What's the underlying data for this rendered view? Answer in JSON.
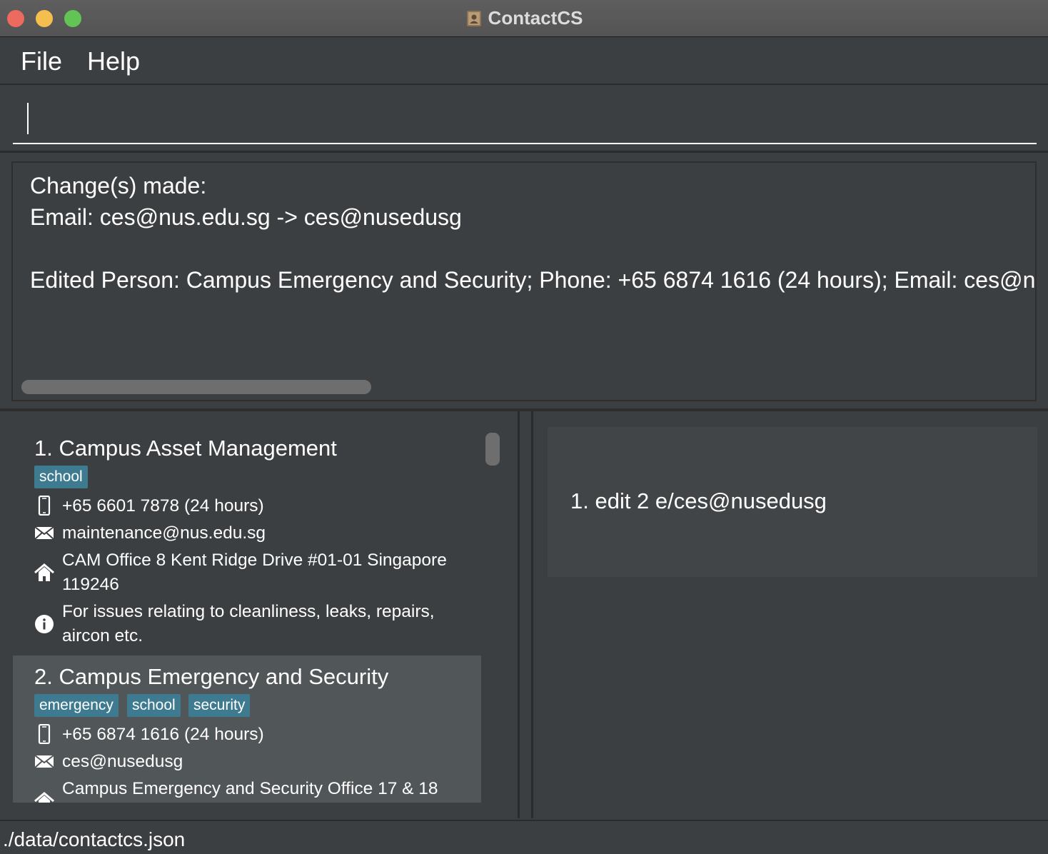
{
  "window": {
    "title": "ContactCS"
  },
  "menu": {
    "file": "File",
    "help": "Help"
  },
  "command": {
    "value": ""
  },
  "result": {
    "line1": "Change(s) made:",
    "line2": "Email: ces@nus.edu.sg -> ces@nusedusg",
    "line3": "Edited Person: Campus Emergency and Security; Phone: +65 6874 1616 (24 hours); Email: ces@nusedusg"
  },
  "contacts": [
    {
      "name": "1. Campus Asset Management",
      "tags": [
        "school"
      ],
      "phone": "+65 6601 7878 (24 hours)",
      "email": "maintenance@nus.edu.sg",
      "address_line1": "CAM Office 8 Kent Ridge Drive #01-01 Singapore",
      "address_line2": "119246",
      "description_line1": "For issues relating to cleanliness, leaks, repairs,",
      "description_line2": "aircon etc."
    },
    {
      "name": "2. Campus Emergency and Security",
      "tags": [
        "emergency",
        "school",
        "security"
      ],
      "phone": "+65 6874 1616 (24 hours)",
      "email": "ces@nusedusg",
      "address_line1": "Campus Emergency and Security Office 17 & 18"
    }
  ],
  "history": [
    "1. edit 2 e/ces@nusedusg"
  ],
  "status": {
    "file_path": "./data/contactcs.json"
  },
  "icons": {
    "app": "contact-book-icon",
    "phone": "phone-icon",
    "email": "envelope-icon",
    "address": "home-icon",
    "description": "info-icon"
  },
  "colors": {
    "tag": "#3e7b91",
    "selected_card": "#515658",
    "background": "#3c3f41"
  }
}
